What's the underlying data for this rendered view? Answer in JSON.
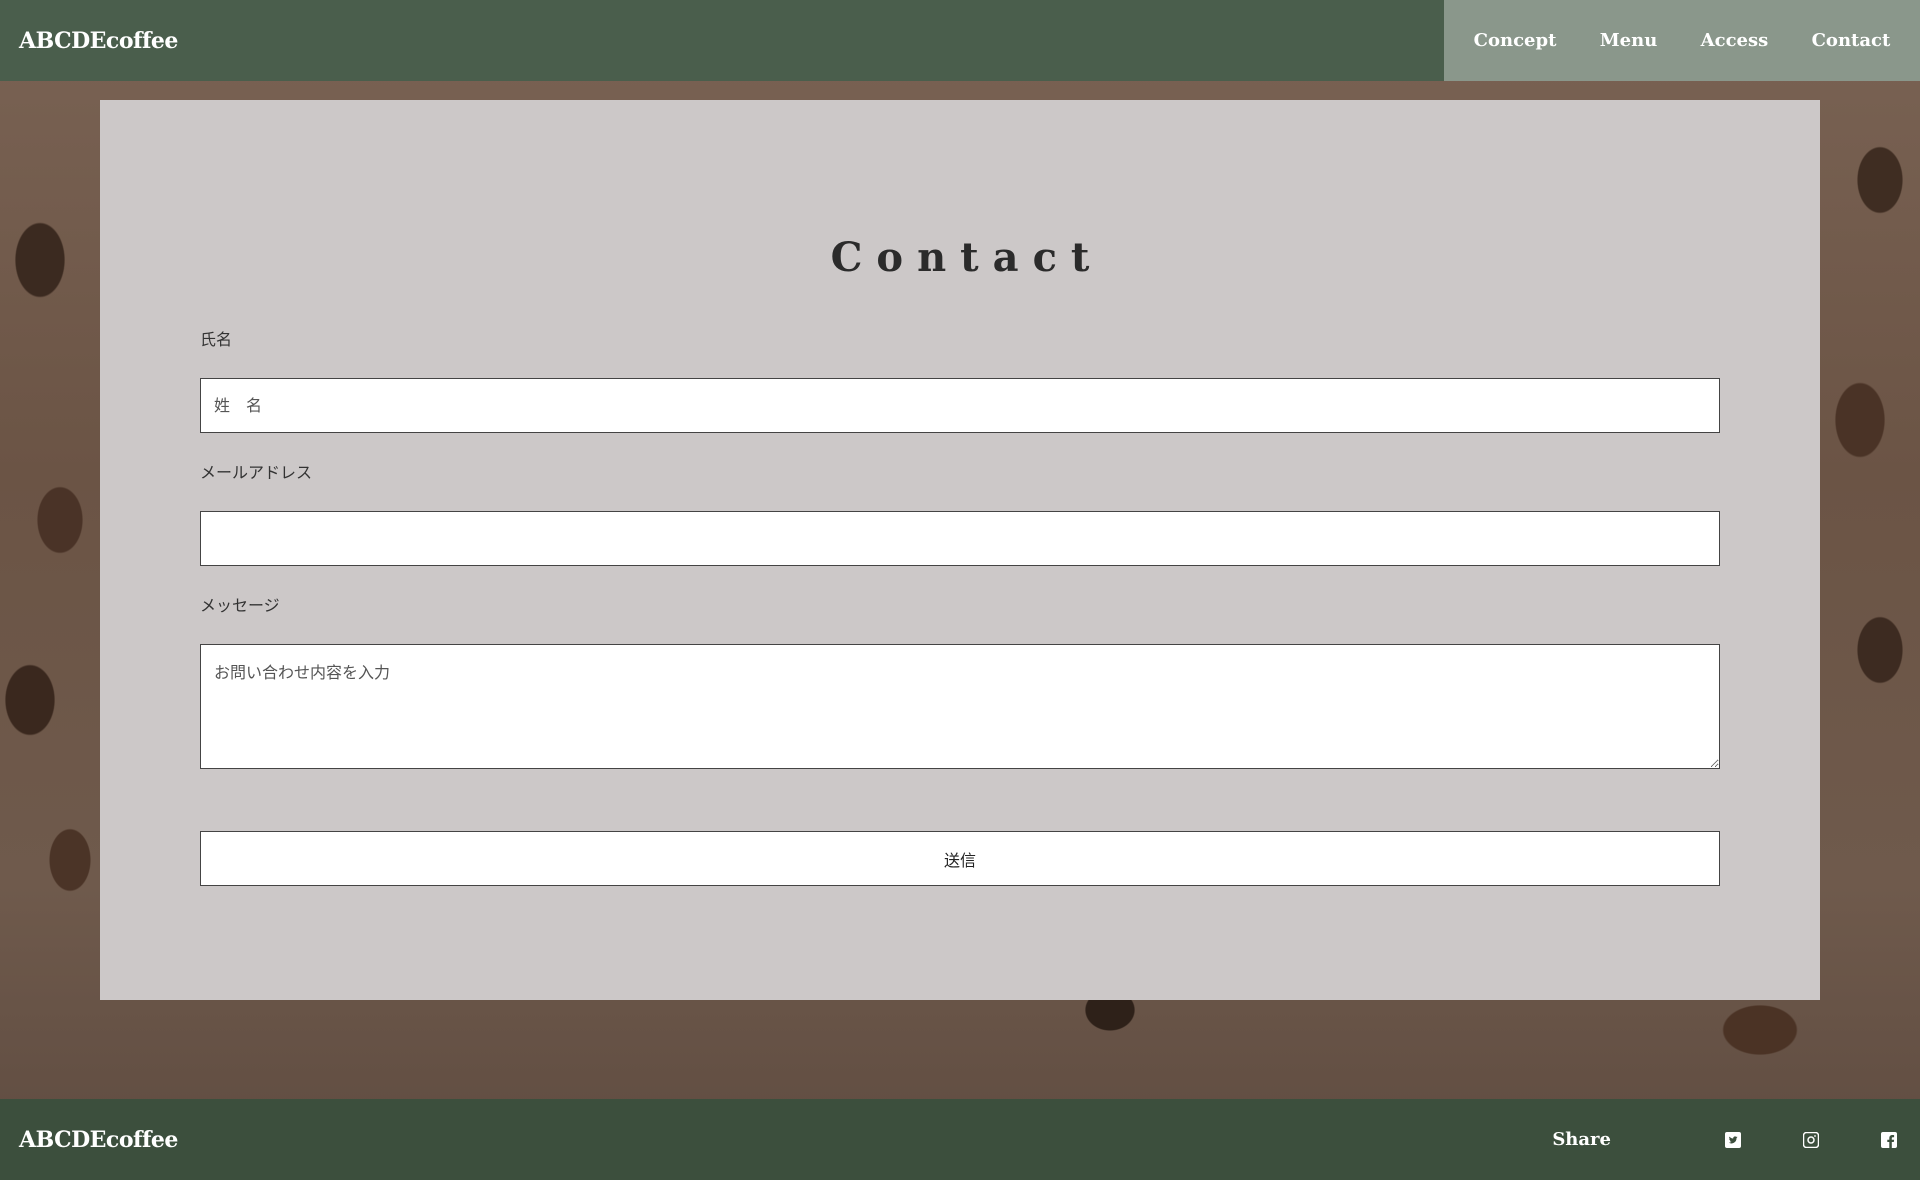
{
  "header": {
    "logo": "ABCDEcoffee",
    "nav": [
      "Concept",
      "Menu",
      "Access",
      "Contact"
    ]
  },
  "contact": {
    "title": "Contact",
    "name_label": "氏名",
    "name_placeholder": "姓　名",
    "email_label": "メールアドレス",
    "email_placeholder": "",
    "message_label": "メッセージ",
    "message_placeholder": "お問い合わせ内容を入力",
    "submit_label": "送信"
  },
  "footer": {
    "logo": "ABCDEcoffee",
    "share_label": "Share",
    "social_icons": [
      "twitter-icon",
      "instagram-icon",
      "facebook-icon"
    ]
  },
  "colors": {
    "header_bg": "#4a5e4c",
    "nav_bg": "#8a978b",
    "footer_bg": "#3c4f3d",
    "panel_bg": "#ccc8c8"
  }
}
